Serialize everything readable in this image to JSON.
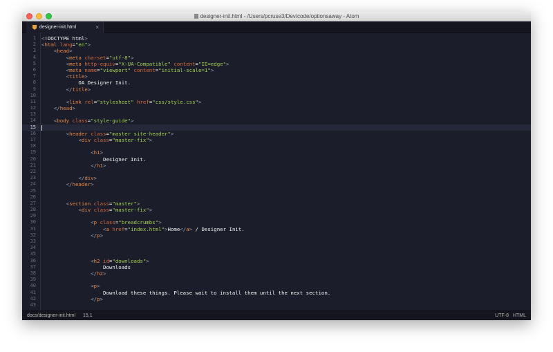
{
  "window": {
    "title": "designer-init.html - /Users/pcruse3/Dev/code/optionsaway - Atom"
  },
  "tabs": [
    {
      "label": "designer-init.html",
      "close": "×"
    }
  ],
  "editor": {
    "current_line": 15,
    "lines": [
      [
        [
          "p",
          "<"
        ],
        [
          "x",
          "!DOCTYPE html"
        ],
        [
          "p",
          ">"
        ]
      ],
      [
        [
          "p",
          "<"
        ],
        [
          "t",
          "html"
        ],
        [
          "x",
          " "
        ],
        [
          "a",
          "lang"
        ],
        [
          "x",
          "="
        ],
        [
          "s",
          "\"en\""
        ],
        [
          "p",
          ">"
        ]
      ],
      [
        [
          "x",
          "    "
        ],
        [
          "p",
          "<"
        ],
        [
          "t",
          "head"
        ],
        [
          "p",
          ">"
        ]
      ],
      [
        [
          "x",
          "        "
        ],
        [
          "p",
          "<"
        ],
        [
          "t",
          "meta"
        ],
        [
          "x",
          " "
        ],
        [
          "a",
          "charset"
        ],
        [
          "x",
          "="
        ],
        [
          "s",
          "\"utf-8\""
        ],
        [
          "p",
          ">"
        ]
      ],
      [
        [
          "x",
          "        "
        ],
        [
          "p",
          "<"
        ],
        [
          "t",
          "meta"
        ],
        [
          "x",
          " "
        ],
        [
          "a",
          "http-equiv"
        ],
        [
          "x",
          "="
        ],
        [
          "s",
          "\"X-UA-Compatible\""
        ],
        [
          "x",
          " "
        ],
        [
          "a",
          "content"
        ],
        [
          "x",
          "="
        ],
        [
          "s",
          "\"IE=edge\""
        ],
        [
          "p",
          ">"
        ]
      ],
      [
        [
          "x",
          "        "
        ],
        [
          "p",
          "<"
        ],
        [
          "t",
          "meta"
        ],
        [
          "x",
          " "
        ],
        [
          "a",
          "name"
        ],
        [
          "x",
          "="
        ],
        [
          "s",
          "\"viewport\""
        ],
        [
          "x",
          " "
        ],
        [
          "a",
          "content"
        ],
        [
          "x",
          "="
        ],
        [
          "s",
          "\"initial-scale=1\""
        ],
        [
          "p",
          ">"
        ]
      ],
      [
        [
          "x",
          "        "
        ],
        [
          "p",
          "<"
        ],
        [
          "t",
          "title"
        ],
        [
          "p",
          ">"
        ]
      ],
      [
        [
          "x",
          "            OA Designer Init."
        ]
      ],
      [
        [
          "x",
          "        "
        ],
        [
          "p",
          "</"
        ],
        [
          "t",
          "title"
        ],
        [
          "p",
          ">"
        ]
      ],
      [],
      [
        [
          "x",
          "        "
        ],
        [
          "p",
          "<"
        ],
        [
          "t",
          "link"
        ],
        [
          "x",
          " "
        ],
        [
          "a",
          "rel"
        ],
        [
          "x",
          "="
        ],
        [
          "s",
          "\"stylesheet\""
        ],
        [
          "x",
          " "
        ],
        [
          "a",
          "href"
        ],
        [
          "x",
          "="
        ],
        [
          "s",
          "\"css/style.css\""
        ],
        [
          "p",
          ">"
        ]
      ],
      [
        [
          "x",
          "    "
        ],
        [
          "p",
          "</"
        ],
        [
          "t",
          "head"
        ],
        [
          "p",
          ">"
        ]
      ],
      [],
      [
        [
          "x",
          "    "
        ],
        [
          "p",
          "<"
        ],
        [
          "t",
          "body"
        ],
        [
          "x",
          " "
        ],
        [
          "a",
          "class"
        ],
        [
          "x",
          "="
        ],
        [
          "s",
          "\"style-guide\""
        ],
        [
          "p",
          ">"
        ]
      ],
      [],
      [
        [
          "x",
          "        "
        ],
        [
          "p",
          "<"
        ],
        [
          "t",
          "header"
        ],
        [
          "x",
          " "
        ],
        [
          "a",
          "class"
        ],
        [
          "x",
          "="
        ],
        [
          "s",
          "\"master site-header\""
        ],
        [
          "p",
          ">"
        ]
      ],
      [
        [
          "x",
          "            "
        ],
        [
          "p",
          "<"
        ],
        [
          "t",
          "div"
        ],
        [
          "x",
          " "
        ],
        [
          "a",
          "class"
        ],
        [
          "x",
          "="
        ],
        [
          "s",
          "\"master-fix\""
        ],
        [
          "p",
          ">"
        ]
      ],
      [],
      [
        [
          "x",
          "                "
        ],
        [
          "p",
          "<"
        ],
        [
          "t",
          "h1"
        ],
        [
          "p",
          ">"
        ]
      ],
      [
        [
          "x",
          "                    Designer Init."
        ]
      ],
      [
        [
          "x",
          "                "
        ],
        [
          "p",
          "</"
        ],
        [
          "t",
          "h1"
        ],
        [
          "p",
          ">"
        ]
      ],
      [],
      [
        [
          "x",
          "            "
        ],
        [
          "p",
          "</"
        ],
        [
          "t",
          "div"
        ],
        [
          "p",
          ">"
        ]
      ],
      [
        [
          "x",
          "        "
        ],
        [
          "p",
          "</"
        ],
        [
          "t",
          "header"
        ],
        [
          "p",
          ">"
        ]
      ],
      [],
      [],
      [
        [
          "x",
          "        "
        ],
        [
          "p",
          "<"
        ],
        [
          "t",
          "section"
        ],
        [
          "x",
          " "
        ],
        [
          "a",
          "class"
        ],
        [
          "x",
          "="
        ],
        [
          "s",
          "\"master\""
        ],
        [
          "p",
          ">"
        ]
      ],
      [
        [
          "x",
          "            "
        ],
        [
          "p",
          "<"
        ],
        [
          "t",
          "div"
        ],
        [
          "x",
          " "
        ],
        [
          "a",
          "class"
        ],
        [
          "x",
          "="
        ],
        [
          "s",
          "\"master-fix\""
        ],
        [
          "p",
          ">"
        ]
      ],
      [],
      [
        [
          "x",
          "                "
        ],
        [
          "p",
          "<"
        ],
        [
          "t",
          "p"
        ],
        [
          "x",
          " "
        ],
        [
          "a",
          "class"
        ],
        [
          "x",
          "="
        ],
        [
          "s",
          "\"breadcrumbs\""
        ],
        [
          "p",
          ">"
        ]
      ],
      [
        [
          "x",
          "                    "
        ],
        [
          "p",
          "<"
        ],
        [
          "t",
          "a"
        ],
        [
          "x",
          " "
        ],
        [
          "a",
          "href"
        ],
        [
          "x",
          "="
        ],
        [
          "s",
          "\"index.html\""
        ],
        [
          "p",
          ">"
        ],
        [
          "x",
          "Home"
        ],
        [
          "p",
          "</"
        ],
        [
          "t",
          "a"
        ],
        [
          "p",
          ">"
        ],
        [
          "x",
          " / Designer Init."
        ]
      ],
      [
        [
          "x",
          "                "
        ],
        [
          "p",
          "</"
        ],
        [
          "t",
          "p"
        ],
        [
          "p",
          ">"
        ]
      ],
      [],
      [],
      [],
      [
        [
          "x",
          "                "
        ],
        [
          "p",
          "<"
        ],
        [
          "t",
          "h2"
        ],
        [
          "x",
          " "
        ],
        [
          "a",
          "id"
        ],
        [
          "x",
          "="
        ],
        [
          "s",
          "\"downloads\""
        ],
        [
          "p",
          ">"
        ]
      ],
      [
        [
          "x",
          "                    Downloads"
        ]
      ],
      [
        [
          "x",
          "                "
        ],
        [
          "p",
          "</"
        ],
        [
          "t",
          "h2"
        ],
        [
          "p",
          ">"
        ]
      ],
      [],
      [
        [
          "x",
          "                "
        ],
        [
          "p",
          "<"
        ],
        [
          "t",
          "p"
        ],
        [
          "p",
          ">"
        ]
      ],
      [
        [
          "x",
          "                    Download these things. Please wait to install them until the next section."
        ]
      ],
      [
        [
          "x",
          "                "
        ],
        [
          "p",
          "</"
        ],
        [
          "t",
          "p"
        ],
        [
          "p",
          ">"
        ]
      ],
      []
    ]
  },
  "statusbar": {
    "path": "docs/designer-init.html",
    "position": "15,1",
    "encoding": "UTF-8",
    "grammar": "HTML"
  },
  "colors": {
    "tag": "#e88743",
    "attribute": "#d66b3b",
    "string": "#a4cf52",
    "editor_background": "#1b1d2a"
  }
}
